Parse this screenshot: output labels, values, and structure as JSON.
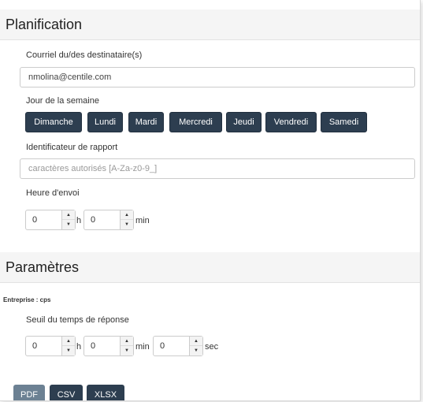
{
  "planification": {
    "title": "Planification",
    "email_label": "Courriel du/des destinataire(s)",
    "email_value": "nmolina@centile.com",
    "day_label": "Jour de la semaine",
    "days": [
      "Dimanche",
      "Lundi",
      "Mardi",
      "Mercredi",
      "Jeudi",
      "Vendredi",
      "Samedi"
    ],
    "report_id_label": "Identificateur de rapport",
    "report_id_placeholder": "caractères autorisés [A-Za-z0-9_]",
    "send_time_label": "Heure d'envoi",
    "send_time": {
      "hours": "0",
      "hours_unit": "h",
      "minutes": "0",
      "minutes_unit": "min"
    }
  },
  "parametres": {
    "title": "Paramètres",
    "company_label": "Entreprise : cps",
    "threshold_label": "Seuil du temps de réponse",
    "threshold": {
      "hours": "0",
      "hours_unit": "h",
      "minutes": "0",
      "minutes_unit": "min",
      "seconds": "0",
      "seconds_unit": "sec"
    }
  },
  "export_buttons": [
    "PDF",
    "CSV",
    "XLSX"
  ],
  "colors": {
    "day_button": "#2d3e50",
    "pdf_button": "#6c8193",
    "csv_xlsx_button": "#2d3e50",
    "header_bg": "#f5f5f5"
  }
}
